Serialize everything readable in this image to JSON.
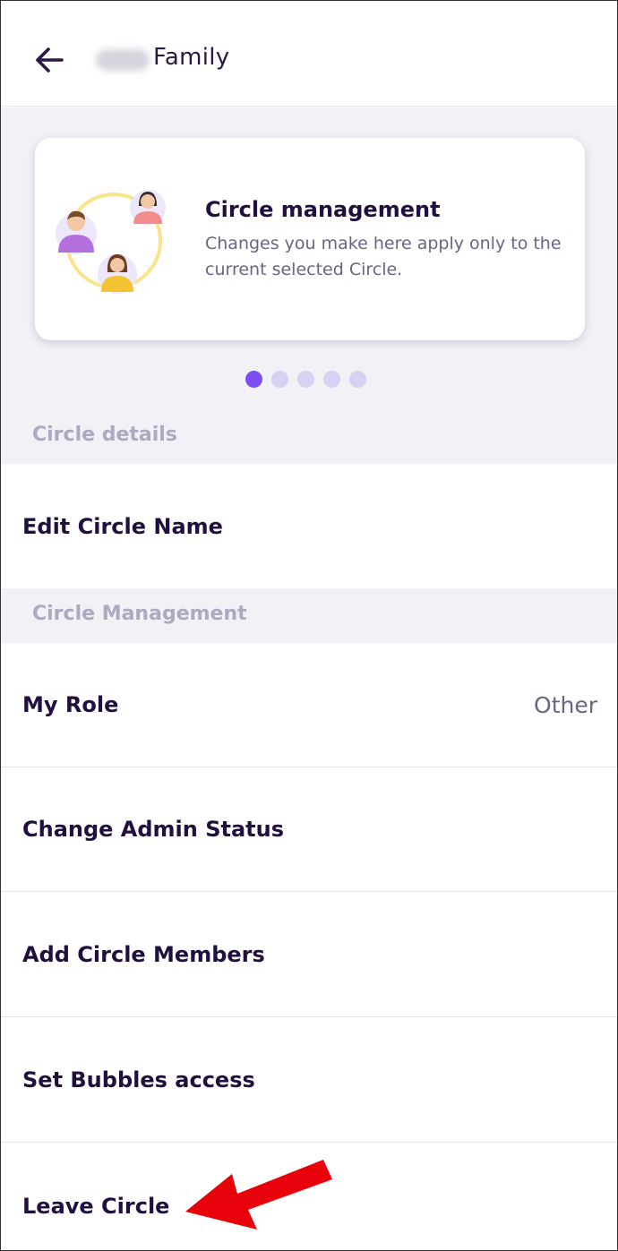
{
  "header": {
    "title": "Family",
    "back_icon": "arrow-left-icon"
  },
  "carousel": {
    "card": {
      "illustration": "circle-members-illustration",
      "title": "Circle management",
      "description": "Changes you make here apply only to the current selected Circle."
    },
    "page_count": 5,
    "active_index": 0,
    "active_color": "#7d4ff3",
    "inactive_color": "#d7d1f4"
  },
  "sections": {
    "details_label": "Circle details",
    "management_label": "Circle Management"
  },
  "rows": {
    "edit_name": "Edit Circle Name",
    "my_role": "My Role",
    "my_role_value": "Other",
    "change_admin": "Change Admin Status",
    "add_members": "Add Circle Members",
    "bubbles": "Set Bubbles access",
    "leave": "Leave Circle"
  },
  "annotation": {
    "arrow_color": "#e8000b"
  }
}
